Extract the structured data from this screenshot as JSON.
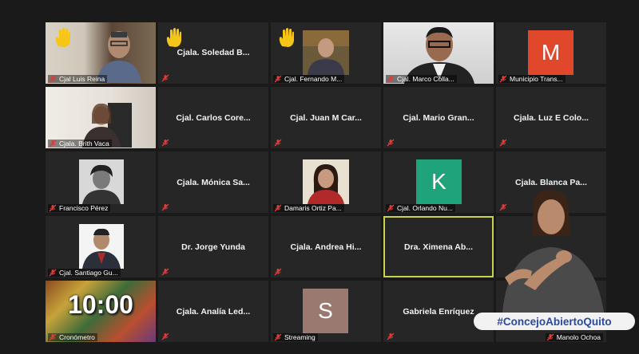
{
  "app": {
    "mode": "gallery-view"
  },
  "colors": {
    "background": "#1a1a1a",
    "tile": "#262626",
    "active_speaker_border": "#c9d34a",
    "muted_mic": "#e03a3a",
    "raised_hand": "#f5c518",
    "hashtag_text": "#2a4aa0"
  },
  "tiles": [
    {
      "label": "Cjal Luis Reina",
      "kind": "video",
      "raised_hand": true
    },
    {
      "label": "Cjala. Soledad B...",
      "kind": "name",
      "raised_hand": true
    },
    {
      "label": "Cjal. Fernando M...",
      "kind": "photo",
      "raised_hand": true
    },
    {
      "label": "Cjal. Marco Colla...",
      "kind": "video"
    },
    {
      "label": "Municipio Trans...",
      "kind": "avatar",
      "initial": "M",
      "avatar_color": "#e0472b"
    },
    {
      "label": "Cjala. Brith Vaca",
      "kind": "video"
    },
    {
      "label": "Cjal. Carlos Core...",
      "kind": "name"
    },
    {
      "label": "Cjal. Juan M Car...",
      "kind": "name"
    },
    {
      "label": "Cjal. Mario Gran...",
      "kind": "name"
    },
    {
      "label": "Cjala. Luz E Colo...",
      "kind": "name"
    },
    {
      "label": "Francisco Pérez",
      "kind": "photo"
    },
    {
      "label": "Cjala. Mónica Sa...",
      "kind": "name"
    },
    {
      "label": "Damaris Ortiz Pa...",
      "kind": "photo"
    },
    {
      "label": "Cjal. Orlando Nu...",
      "kind": "avatar",
      "initial": "K",
      "avatar_color": "#1fa37a"
    },
    {
      "label": "Cjala. Blanca Pa...",
      "kind": "name"
    },
    {
      "label": "Cjal. Santiago Gu...",
      "kind": "photo"
    },
    {
      "label": "Dr. Jorge Yunda",
      "kind": "name"
    },
    {
      "label": "Cjala. Andrea Hi...",
      "kind": "name"
    },
    {
      "label": "Dra. Ximena Ab...",
      "kind": "name",
      "active": true
    },
    {
      "label": "",
      "kind": "interpreter-slot"
    },
    {
      "label": "Cronómetro",
      "kind": "timer",
      "timer": "10:00"
    },
    {
      "label": "Cjala. Analía Led...",
      "kind": "name"
    },
    {
      "label": "Streaming",
      "kind": "avatar",
      "initial": "S",
      "avatar_color": "#9a7a70"
    },
    {
      "label": "Gabriela Enríquez",
      "kind": "name"
    },
    {
      "label": "Manolo Ochoa",
      "kind": "interpreter-slot"
    }
  ],
  "overlay": {
    "hashtag": "#ConcejoAbiertoQuito"
  }
}
